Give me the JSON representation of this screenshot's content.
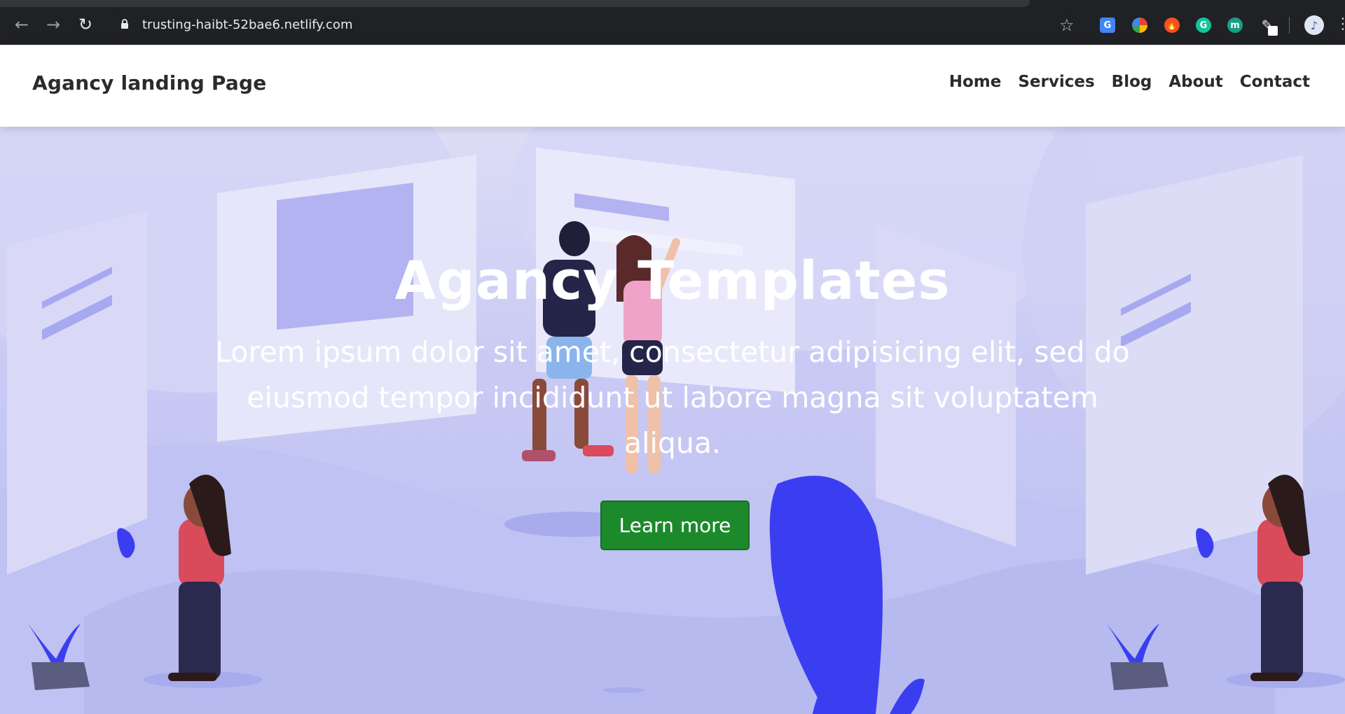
{
  "browser": {
    "url": "trusting-haibt-52bae6.netlify.com",
    "back_icon": "back-arrow-icon",
    "forward_icon": "forward-arrow-icon",
    "reload_icon": "reload-icon",
    "lock_icon": "lock-icon",
    "bookmark_icon": "star-icon",
    "extensions": [
      {
        "name": "translate-extension-icon",
        "glyph": "G"
      },
      {
        "name": "color-extension-icon",
        "glyph": ""
      },
      {
        "name": "fire-extension-icon",
        "glyph": "🔥"
      },
      {
        "name": "grammarly-extension-icon",
        "glyph": "G"
      },
      {
        "name": "m-extension-icon",
        "glyph": "m"
      },
      {
        "name": "pen-extension-icon",
        "glyph": "✎"
      }
    ],
    "profile_glyph": "♪",
    "menu_glyph": "⋮"
  },
  "header": {
    "brand": "Agancy landing Page",
    "nav": [
      "Home",
      "Services",
      "Blog",
      "About",
      "Contact"
    ]
  },
  "hero": {
    "title": "Agancy Templates",
    "text": "Lorem ipsum dolor sit amet, consectetur adipisicing elit, sed do eiusmod tempor incididunt ut labore magna sit voluptatem aliqua.",
    "button": "Learn more"
  },
  "colors": {
    "button_bg": "#1c8a2b",
    "hero_bg": "#c9caf4",
    "accent_plant": "#3b3ef0"
  }
}
